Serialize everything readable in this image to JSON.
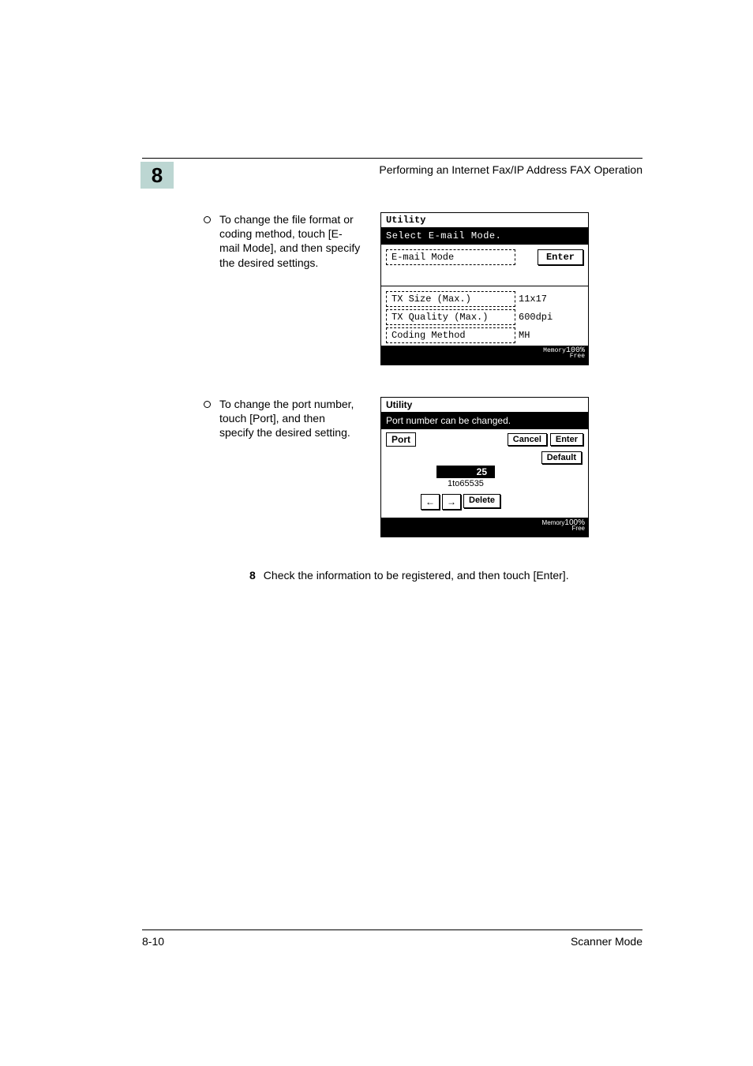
{
  "header": {
    "chapter_number": "8",
    "title": "Performing an Internet Fax/IP Address FAX Operation"
  },
  "bullet1": {
    "text": "To change the file format or coding method, touch [E-mail Mode], and then specify the desired settings."
  },
  "lcd1": {
    "title": "Utility",
    "prompt": "Select E-mail Mode.",
    "email_mode_label": "E-mail Mode",
    "enter_label": "Enter",
    "rows": [
      {
        "label": "TX Size (Max.)",
        "value": "11x17"
      },
      {
        "label": "TX Quality (Max.)",
        "value": "600dpi"
      },
      {
        "label": "Coding Method",
        "value": "MH"
      }
    ],
    "memory_label": "Memory",
    "free_label": "Free",
    "memory_val": "100%"
  },
  "bullet2": {
    "text": "To change the port number, touch [Port], and then specify the desired setting."
  },
  "lcd2": {
    "title": "Utility",
    "prompt": "Port number can be changed.",
    "port_label": "Port",
    "cancel_label": "Cancel",
    "enter_label": "Enter",
    "default_label": "Default",
    "value": "25",
    "range": "1to65535",
    "delete_label": "Delete",
    "left_arrow": "←",
    "right_arrow": "→",
    "memory_label": "Memory",
    "free_label": "Free",
    "memory_val": "100%"
  },
  "step8": {
    "number": "8",
    "text": "Check the information to be registered, and then touch [Enter]."
  },
  "footer": {
    "page": "8-10",
    "doc": "Scanner Mode"
  }
}
